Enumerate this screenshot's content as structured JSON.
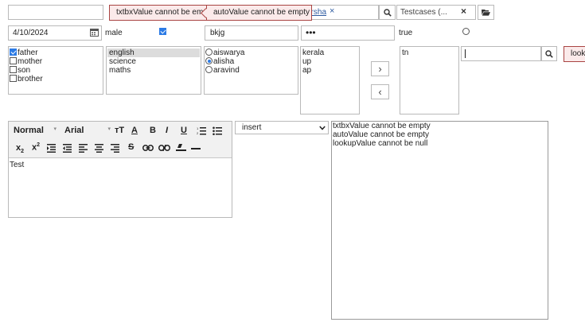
{
  "row1": {
    "textbox_value": "",
    "textbox_error": "txtbxValue cannot be empty",
    "autocomplete_error": "autoValue cannot be empty",
    "multiselect_chip": "arsha",
    "multiselect_chip_remove": "×",
    "dropdown_value": "Testcases (...",
    "dropdown_clear": "×"
  },
  "row2": {
    "date_value": "4/10/2024",
    "checkbox_label": "male",
    "checkbox_checked": true,
    "text_value": "bkjg",
    "password_value": "•••",
    "toggle_label": "true"
  },
  "checklist": {
    "items": [
      {
        "label": "father",
        "checked": true
      },
      {
        "label": "mother",
        "checked": false
      },
      {
        "label": "son",
        "checked": false
      },
      {
        "label": "brother",
        "checked": false
      }
    ]
  },
  "listbox": {
    "items": [
      {
        "label": "english",
        "selected": true
      },
      {
        "label": "science",
        "selected": false
      },
      {
        "label": "maths",
        "selected": false
      }
    ]
  },
  "radiolist": {
    "items": [
      {
        "label": "aiswarya",
        "checked": false
      },
      {
        "label": "alisha",
        "checked": true
      },
      {
        "label": "aravind",
        "checked": false
      }
    ]
  },
  "picklist": {
    "source": [
      "kerala",
      "up",
      "ap"
    ],
    "target": [
      "tn"
    ],
    "move_right_label": "›",
    "move_left_label": "‹"
  },
  "lookup": {
    "input_value": "",
    "error_text": "lookupValue cannot be null"
  },
  "editor": {
    "format_label": "Normal",
    "font_label": "Arial",
    "content": "Test"
  },
  "action_select": {
    "value": "insert"
  },
  "log": {
    "lines": [
      "txtbxValue cannot be empty",
      "autoValue cannot be empty",
      "lookupValue cannot be null"
    ]
  },
  "colors": {
    "error_border": "#a94442",
    "error_bg": "#fbeaea",
    "selected_bg": "#dcdcdc",
    "check_blue": "#2c7be5"
  }
}
